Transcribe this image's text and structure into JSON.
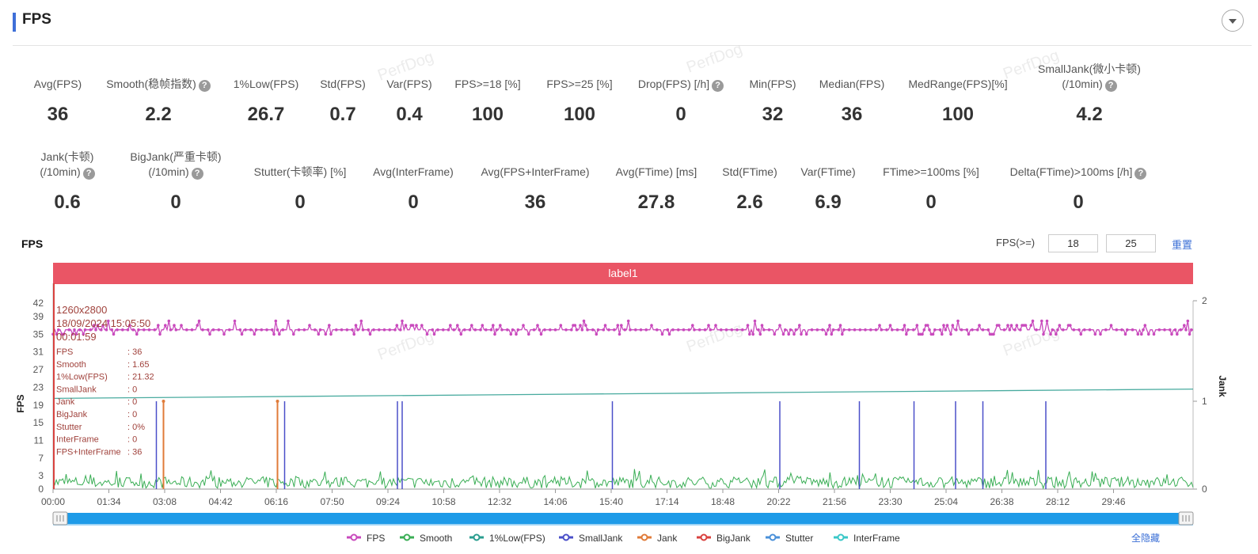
{
  "header": {
    "title": "FPS"
  },
  "metrics_row1": [
    {
      "label": "Avg(FPS)",
      "value": "36",
      "help": false
    },
    {
      "label": "Smooth(稳帧指数)",
      "value": "2.2",
      "help": true
    },
    {
      "label": "1%Low(FPS)",
      "value": "26.7",
      "help": false
    },
    {
      "label": "Std(FPS)",
      "value": "0.7",
      "help": false
    },
    {
      "label": "Var(FPS)",
      "value": "0.4",
      "help": false
    },
    {
      "label": "FPS>=18 [%]",
      "value": "100",
      "help": false
    },
    {
      "label": "FPS>=25 [%]",
      "value": "100",
      "help": false
    },
    {
      "label": "Drop(FPS) [/h]",
      "value": "0",
      "help": true
    },
    {
      "label": "Min(FPS)",
      "value": "32",
      "help": false
    },
    {
      "label": "Median(FPS)",
      "value": "36",
      "help": false
    },
    {
      "label": "MedRange(FPS)[%]",
      "value": "100",
      "help": false
    },
    {
      "label": "SmallJank(微小卡顿)",
      "label2": "(/10min)",
      "value": "4.2",
      "help": true
    }
  ],
  "metrics_row2": [
    {
      "label": "Jank(卡顿)",
      "label2": "(/10min)",
      "value": "0.6",
      "help": true
    },
    {
      "label": "BigJank(严重卡顿)",
      "label2": "(/10min)",
      "value": "0",
      "help": true
    },
    {
      "label": "Stutter(卡顿率) [%]",
      "value": "0",
      "help": false
    },
    {
      "label": "Avg(InterFrame)",
      "value": "0",
      "help": false
    },
    {
      "label": "Avg(FPS+InterFrame)",
      "value": "36",
      "help": false
    },
    {
      "label": "Avg(FTime) [ms]",
      "value": "27.8",
      "help": false
    },
    {
      "label": "Std(FTime)",
      "value": "2.6",
      "help": false
    },
    {
      "label": "Var(FTime)",
      "value": "6.9",
      "help": false
    },
    {
      "label": "FTime>=100ms [%]",
      "value": "0",
      "help": false
    },
    {
      "label": "Delta(FTime)>100ms [/h]",
      "value": "0",
      "help": true
    }
  ],
  "chart_controls": {
    "title": "FPS",
    "threshold_label": "FPS(>=)",
    "threshold_1": "18",
    "threshold_2": "25",
    "reset_label": "重置",
    "hide_all_label": "全隐藏"
  },
  "label_bar": "label1",
  "watermark": "PerfDog",
  "tooltip": {
    "lines": [
      "1260x2800",
      "18/09/2024 15:05:50",
      "00:01:59"
    ],
    "rows": [
      [
        "FPS",
        ": 36"
      ],
      [
        "Smooth",
        ": 1.65"
      ],
      [
        "1%Low(FPS)",
        ": 21.32"
      ],
      [
        "SmallJank",
        ": 0"
      ],
      [
        "Jank",
        ": 0"
      ],
      [
        "BigJank",
        ": 0"
      ],
      [
        "Stutter",
        ": 0%"
      ],
      [
        "InterFrame",
        ": 0"
      ],
      [
        "FPS+InterFrame",
        ": 36"
      ]
    ]
  },
  "colors": {
    "fps": "#c94bbd",
    "smooth": "#3aae55",
    "low1": "#2a9d8f",
    "smalljank": "#4a4fc9",
    "jank": "#e07b39",
    "bigjank": "#d9423f",
    "stutter": "#4a90d9",
    "interframe": "#3ac8c8",
    "label_bar": "#ea5565",
    "slider": "#1e9be8"
  },
  "chart_data": {
    "type": "line",
    "xlabel": "",
    "ylabel": "FPS",
    "ylabel_right": "Jank",
    "y_ticks": [
      "0",
      "3",
      "7",
      "11",
      "15",
      "19",
      "23",
      "27",
      "31",
      "35",
      "39",
      "42"
    ],
    "y_right_ticks": [
      "0",
      "1",
      "2"
    ],
    "x_ticks": [
      "00:00",
      "01:34",
      "03:08",
      "04:42",
      "06:16",
      "07:50",
      "09:24",
      "10:58",
      "12:32",
      "14:06",
      "15:40",
      "17:14",
      "18:48",
      "20:22",
      "21:56",
      "23:30",
      "25:04",
      "26:38",
      "28:12",
      "29:46"
    ],
    "x_range_seconds": [
      0,
      1920
    ],
    "y_range": [
      0,
      44
    ],
    "fps_baseline": 36,
    "low1_start": 20.5,
    "low1_end": 22.6,
    "smooth_typical_range": [
      0,
      4
    ],
    "smalljank_events_time": [
      "02:54",
      "06:30",
      "09:40",
      "09:48",
      "15:42",
      "20:24",
      "22:38",
      "24:10",
      "25:20",
      "26:06",
      "27:52"
    ],
    "jank_events_time": [
      "03:06",
      "06:18"
    ],
    "series": [
      {
        "name": "FPS",
        "color": "#c94bbd"
      },
      {
        "name": "Smooth",
        "color": "#3aae55"
      },
      {
        "name": "1%Low(FPS)",
        "color": "#2a9d8f"
      },
      {
        "name": "SmallJank",
        "color": "#4a4fc9"
      },
      {
        "name": "Jank",
        "color": "#e07b39"
      },
      {
        "name": "BigJank",
        "color": "#d9423f"
      },
      {
        "name": "Stutter",
        "color": "#4a90d9"
      },
      {
        "name": "InterFrame",
        "color": "#3ac8c8"
      }
    ]
  }
}
